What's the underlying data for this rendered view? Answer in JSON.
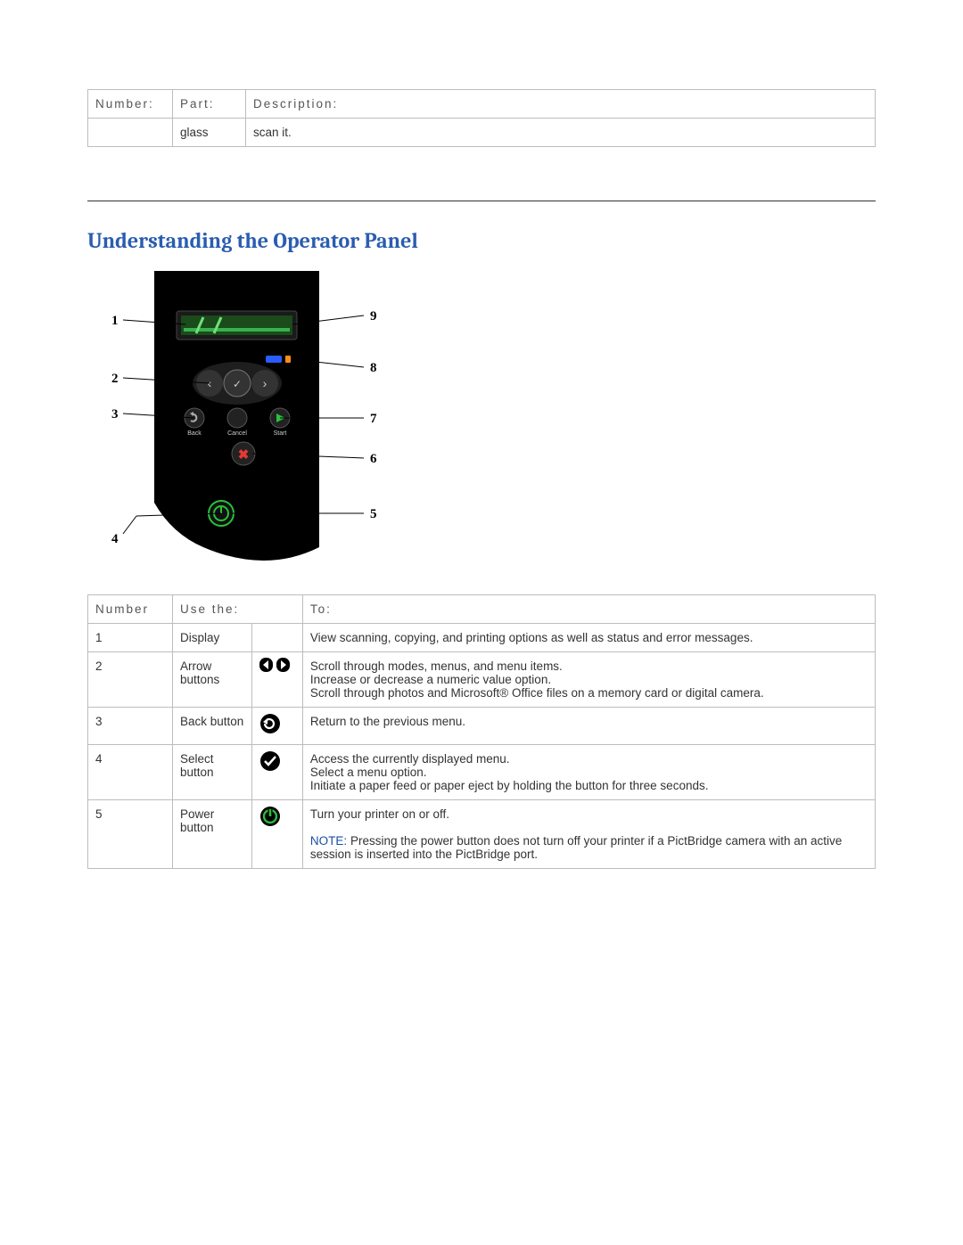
{
  "top_table": {
    "headers": {
      "c1": "Number:",
      "c2": "Part:",
      "c3": "Description:"
    },
    "row": {
      "c1": "",
      "c2": "glass",
      "c3": "scan it."
    }
  },
  "section_title": "Understanding the Operator Panel",
  "diagram": {
    "labels": {
      "n1": "1",
      "n2": "2",
      "n3": "3",
      "n4": "4",
      "n5": "5",
      "n6": "6",
      "n7": "7",
      "n8": "8",
      "n9": "9"
    },
    "btn_labels": {
      "back": "Back",
      "cancel": "Cancel",
      "start": "Start"
    }
  },
  "panel_table": {
    "headers": {
      "c1": "Number",
      "c2": "Use the:",
      "c3": "To:"
    },
    "rows": [
      {
        "num": "1",
        "use": "Display",
        "icon": null,
        "to": "View scanning, copying, and printing options as well as status and error messages."
      },
      {
        "num": "2",
        "use": "Arrow buttons",
        "icon": "arrows",
        "to_lines": [
          "Scroll through modes, menus, and menu items.",
          "Increase or decrease a numeric value option.",
          "Scroll through photos and Microsoft® Office files on a memory card or digital camera."
        ]
      },
      {
        "num": "3",
        "use": "Back button",
        "icon": "back",
        "to": "Return to the previous menu."
      },
      {
        "num": "4",
        "use": "Select button",
        "icon": "select",
        "to_lines": [
          "Access the currently displayed menu.",
          "Select a menu option.",
          "Initiate a paper feed or paper eject by holding the button for three seconds."
        ]
      },
      {
        "num": "5",
        "use": "Power button",
        "icon": "power",
        "to_main": "Turn your printer on or off.",
        "note_label": "NOTE:",
        "note_body": " Pressing the power button does not turn off your printer if a PictBridge camera with an active session is inserted into the PictBridge port."
      }
    ]
  }
}
